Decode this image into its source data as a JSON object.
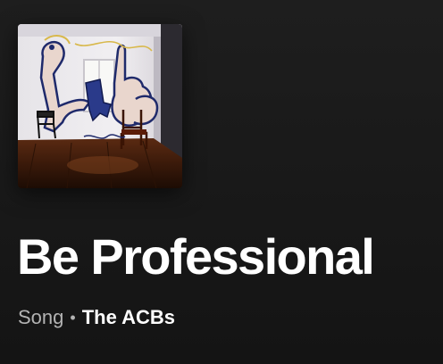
{
  "track": {
    "title": "Be Professional",
    "type": "Song",
    "separator": "•",
    "artist": "The ACBs"
  },
  "cover": {
    "icon": "album-cover-image"
  },
  "colors": {
    "background": "#181818",
    "title": "#ffffff",
    "meta_muted": "#b3b3b3",
    "artist": "#ffffff"
  }
}
